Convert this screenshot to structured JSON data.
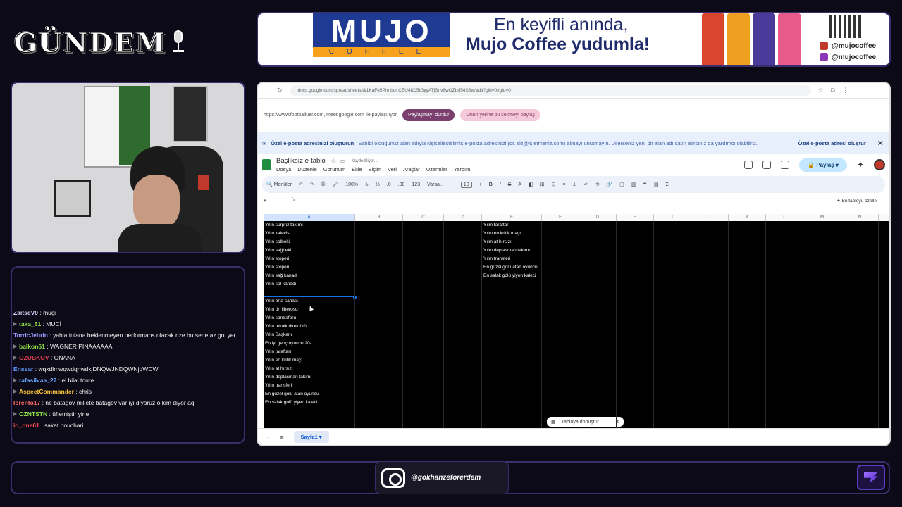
{
  "stream": {
    "logo_text": "GÜNDEM",
    "instagram_handle": "@gokhanzeforerdem"
  },
  "ad": {
    "brand": "MUJO",
    "brand_sub": "COFFEE",
    "line1": "En keyifli anında,",
    "line2": "Mujo Coffee yudumla!",
    "facebook": "@mujocoffee",
    "instagram": "@mujocoffee"
  },
  "chat": [
    {
      "user": "ZaitseV0",
      "msg": ": muçi",
      "color": "#d7d7ff",
      "badge": false
    },
    {
      "user": "taka_61",
      "msg": ": MUCİ",
      "color": "#8fe04a",
      "badge": true
    },
    {
      "user": "TorricJebrin",
      "msg": ": yahia fofana beklenmeyen performans olacak rize bu sene az gol yer",
      "color": "#9a9aff",
      "badge": false,
      "wrap": true
    },
    {
      "user": "balkon61",
      "msg": ": WAGNER PINAAAAAA",
      "color": "#8fe04a",
      "badge": true
    },
    {
      "user": "OZUBKOV",
      "msg": ": ONANA",
      "color": "#e0434f",
      "badge": true
    },
    {
      "user": "Enssar",
      "msg": ": wqkdlmwqwdqnwdkjDNQWJNDQWNjqWDW",
      "color": "#5f9bff",
      "badge": false
    },
    {
      "user": "rafasilvaa_27",
      "msg": ": el bilal toure",
      "color": "#6aa9ff",
      "badge": true
    },
    {
      "user": "AspectCommander",
      "msg": ": chris",
      "color": "#f7c23b",
      "badge": true
    },
    {
      "user": "lorento17",
      "msg": ": ne batagov millete batagov var iyi diyoruz o kim diyor aq",
      "color": "#ff6a6a",
      "badge": false
    },
    {
      "user": "OZNTSTN",
      "msg": ": üflemiştir yine",
      "color": "#8fe04a",
      "badge": true
    },
    {
      "user": "id_one61",
      "msg": ": sakat bouchari",
      "color": "#ff4f4f",
      "badge": false
    }
  ],
  "browser": {
    "url": "docs.google.com/spreadsheets/d/1KaFe5Phnbdr CEU4ftD5tGyyATjSnv6wOZbrf54S8w/edit?gid=0#gid=0",
    "share_text": "https://www.footballuer.com, meet.google.com ile paylaşılıyor",
    "stop_share": "Paylaşmayı durdur",
    "switch_share": "Onun yerine bu sekmeyi paylaş"
  },
  "notice": {
    "title": "Özel e-posta adresinizi oluşturun",
    "desc": "Sahibi olduğunuz alan adıyla kişiselleştirilmiş e-posta adresinizi (ör. siz@işletmeniz.com) almayı unutmayın. Dilerseniz yeni bir alan adı satın alırsınız da yardımcı olabiliriz.",
    "action": "Özel e-posta adresi oluştur",
    "close": "✕"
  },
  "doc": {
    "title": "Başlıksız e-tablo",
    "saving": "Kaydediliyor...",
    "menus": [
      "Dosya",
      "Düzenle",
      "Görünüm",
      "Ekle",
      "Biçim",
      "Veri",
      "Araçlar",
      "Uzantılar",
      "Yardım"
    ],
    "share_label": "Paylaş"
  },
  "toolbar": {
    "menus": "Menüler",
    "zoom": "100%",
    "currency": "₺",
    "percent": "%",
    "dec_less": ".0",
    "dec_more": ".00",
    "num_format": "123",
    "font": "Varsa...",
    "font_size": "10",
    "bold": "B",
    "italic": "I",
    "strike": "S",
    "text_color": "A",
    "sum": "Σ"
  },
  "formula_bar": {
    "fx": "fx",
    "customize": "Bu tabloyu özelle"
  },
  "grid": {
    "columns": [
      "A",
      "B",
      "C",
      "D",
      "E",
      "F",
      "G",
      "H",
      "I",
      "J",
      "K",
      "L",
      "M",
      "N"
    ],
    "col_a": [
      "Yılın sürpriz takımı",
      "Yılın kalecisi",
      "Yılın solbeki",
      "Yılın sağbeki",
      "Yılın stoperi",
      "Yılın stoperi",
      "Yılın sağ kanadı",
      "Yılın sol kanadı",
      "",
      "Yılın orta sahası",
      "Yılın ön liberosu",
      "Yılın santraforu",
      "Yılın teknik direktörü",
      "Yılın Başkanı",
      "En iyi genç oyuncu 20-",
      "Yılın taraftarı",
      "Yılın en kritik maçı",
      "Yılın at hırsızı",
      "Yılın deplasman takımı",
      "Yılın transferi",
      "En güzel golü atan oyuncu",
      "En salak golü yiyen kaleci"
    ],
    "col_e": [
      "Yılın taraftarı",
      "Yılın en kritik maçı",
      "Yılın at hırsızı",
      "Yılın deplasman takımı",
      "Yılın transferi",
      "En güzel golü atan oyuncu",
      "En salak golü yiyen kaleci"
    ],
    "convert_chip": "Tabloya dönüştür",
    "chip_more": "⋮",
    "chip_close": "✕"
  },
  "sheet_tabs": {
    "add": "+",
    "list": "≡",
    "sheet1": "Sayfa1 ▾"
  }
}
